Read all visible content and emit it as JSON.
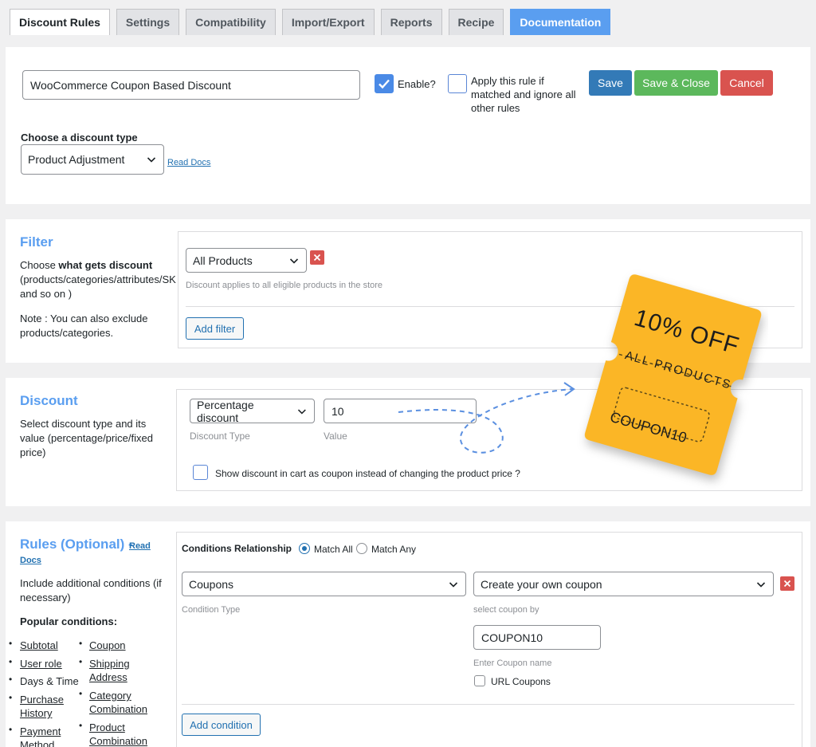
{
  "tabs": [
    {
      "label": "Discount Rules",
      "active": true
    },
    {
      "label": "Settings"
    },
    {
      "label": "Compatibility"
    },
    {
      "label": "Import/Export"
    },
    {
      "label": "Reports"
    },
    {
      "label": "Recipe"
    },
    {
      "label": "Documentation"
    }
  ],
  "header": {
    "rule_name": "WooCommerce Coupon Based Discount",
    "enable_label": "Enable?",
    "enable_checked": true,
    "apply_rule_label_1": "Apply this rule if",
    "apply_rule_label_2": "matched and ignore all",
    "apply_rule_label_3": "other rules",
    "apply_rule_checked": false,
    "save": "Save",
    "save_close": "Save & Close",
    "cancel": "Cancel",
    "discount_type_label": "Choose a discount type",
    "discount_type_value": "Product Adjustment",
    "read_docs": "Read Docs"
  },
  "filter": {
    "title": "Filter",
    "desc_prefix": "Choose ",
    "desc_bold": "what gets discount",
    "desc_line2": "(products/categories/attributes/SK",
    "desc_line3": "and so on )",
    "note_line1": "Note : You can also exclude",
    "note_line2": "products/categories.",
    "select_value": "All Products",
    "hint": "Discount applies to all eligible products in the store",
    "add_filter": "Add filter"
  },
  "discount": {
    "title": "Discount",
    "desc_line1": "Select discount type and its",
    "desc_line2": "value (percentage/price/fixed",
    "desc_line3": "price)",
    "type_value": "Percentage discount",
    "type_hint": "Discount Type",
    "value": "10",
    "value_hint": "Value",
    "coupon_checkbox_label": "Show discount in cart as coupon instead of changing the product price ?",
    "coupon_checkbox_checked": false
  },
  "coupon_graphic": {
    "headline": "10% OFF",
    "subline": "ALL PRODUCTS",
    "code": "COUPON10",
    "color": "#fbb626"
  },
  "rules": {
    "title": "Rules (Optional)",
    "dash": " - ",
    "read_docs_1": "Read",
    "read_docs_2": "Docs",
    "desc_line1": "Include additional conditions (if",
    "desc_line2": "necessary)",
    "popular_label": "Popular conditions:",
    "popular_left": [
      {
        "line1": "Subtotal",
        "link": true
      },
      {
        "line1": "User role",
        "link": true
      },
      {
        "line1": "Days & Time",
        "link": false
      },
      {
        "line1": "Purchase",
        "line2": "History",
        "link": true
      },
      {
        "line1": "Payment",
        "line2": "Method",
        "link": true
      }
    ],
    "popular_right": [
      {
        "line1": "Coupon",
        "link": true
      },
      {
        "line1": "Shipping",
        "line2": "Address",
        "link": true
      },
      {
        "line1": "Category",
        "line2": "Combination",
        "link": true
      },
      {
        "line1": "Product",
        "line2": "Combination",
        "link": true
      }
    ],
    "relationship_label": "Conditions Relationship",
    "match_all": "Match All",
    "match_any": "Match Any",
    "condition_type_value": "Coupons",
    "condition_type_hint": "Condition Type",
    "coupon_select_value": "Create your own coupon",
    "coupon_select_hint": "select coupon by",
    "coupon_name_value": "COUPON10",
    "coupon_name_hint": "Enter Coupon name",
    "url_coupons": "URL Coupons",
    "add_condition": "Add condition"
  }
}
